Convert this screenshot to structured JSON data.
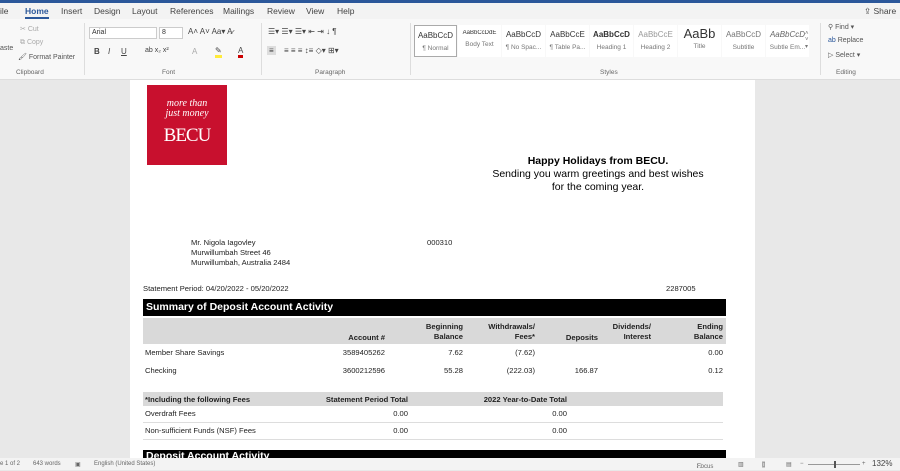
{
  "ribbon": {
    "tabs": [
      "ile",
      "Home",
      "Insert",
      "Design",
      "Layout",
      "References",
      "Mailings",
      "Review",
      "View",
      "Help"
    ],
    "share": "Share",
    "clipboard": {
      "paste": "aste",
      "cut": "Cut",
      "copy": "Copy",
      "format_painter": "Format Painter",
      "label": "Clipboard"
    },
    "font": {
      "name": "Arial",
      "size": "8",
      "label": "Font"
    },
    "paragraph": {
      "label": "Paragraph"
    },
    "styles": {
      "label": "Styles",
      "items": [
        {
          "preview": "AaBbCcD",
          "name": "¶ Normal"
        },
        {
          "preview": "AaBbCcDdE",
          "name": "Body Text"
        },
        {
          "preview": "AaBbCcD",
          "name": "¶ No Spac..."
        },
        {
          "preview": "AaBbCcE",
          "name": "¶ Table Pa..."
        },
        {
          "preview": "AaBbCcD",
          "name": "Heading 1"
        },
        {
          "preview": "AaBbCcE",
          "name": "Heading 2"
        },
        {
          "preview": "AaBb",
          "name": "Title"
        },
        {
          "preview": "AaBbCcD",
          "name": "Subtitle"
        },
        {
          "preview": "AaBbCcD",
          "name": "Subtle Em..."
        }
      ]
    },
    "editing": {
      "find": "Find",
      "replace": "Replace",
      "select": "Select",
      "label": "Editing"
    }
  },
  "doc": {
    "logo": {
      "tagline1": "more than",
      "tagline2": "just money",
      "brand": "BECU",
      "color": "#c8102e"
    },
    "greeting": {
      "title": "Happy Holidays from BECU.",
      "line1": "Sending you warm greetings and best wishes",
      "line2": "for the coming year."
    },
    "address": [
      "Mr. Nigola Iagovley",
      "Murwillumbah Street 46",
      "Murwillumbah, Australia 2484"
    ],
    "code": "000310",
    "period": "Statement Period: 04/20/2022 - 05/20/2022",
    "ref": "2287005",
    "summary": {
      "title": "Summary of Deposit Account Activity",
      "headers": [
        "",
        "Account #",
        "Beginning Balance",
        "Withdrawals/ Fees*",
        "Deposits",
        "Dividends/ Interest",
        "Ending Balance"
      ],
      "rows": [
        [
          "Member Share Savings",
          "3589405262",
          "7.62",
          "(7.62)",
          "",
          "",
          "0.00"
        ],
        [
          "Checking",
          "3600212596",
          "55.28",
          "(222.03)",
          "166.87",
          "",
          "0.12"
        ]
      ]
    },
    "fees": {
      "headers": [
        "*Including the following Fees",
        "Statement Period Total",
        "2022 Year-to-Date Total"
      ],
      "rows": [
        [
          "Overdraft Fees",
          "0.00",
          "0.00"
        ],
        [
          "Non-sufficient Funds (NSF) Fees",
          "0.00",
          "0.00"
        ]
      ]
    },
    "next_section": "Deposit Account Activity"
  },
  "status": {
    "page": "e 1 of 2",
    "words": "643 words",
    "language": "English (United States)",
    "focus": "Focus",
    "zoom": "132%"
  }
}
